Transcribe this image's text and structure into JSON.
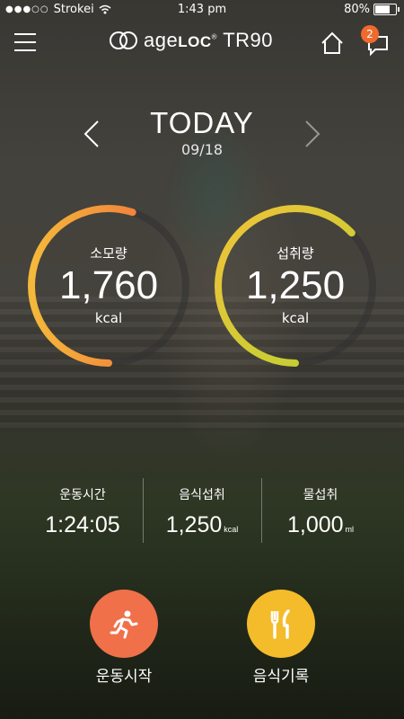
{
  "status_bar": {
    "carrier": "Strokei",
    "time": "1:43 pm",
    "battery": "80%",
    "battery_level": 0.8
  },
  "header": {
    "logo_light": "age",
    "logo_bold": "LOC",
    "logo_reg": "®",
    "logo_product": "TR90",
    "notification_count": "2",
    "icons": [
      "menu-icon",
      "home-icon",
      "chat-icon"
    ]
  },
  "date_nav": {
    "title": "TODAY",
    "date": "09/18"
  },
  "rings": {
    "burned": {
      "label": "소모량",
      "value": "1,760",
      "unit": "kcal",
      "progress": 0.55,
      "colors": [
        "#f16a3c",
        "#f4b93a"
      ]
    },
    "intake": {
      "label": "섭취량",
      "value": "1,250",
      "unit": "kcal",
      "progress": 0.63,
      "colors": [
        "#b9d330",
        "#f0c23a"
      ]
    }
  },
  "stats": [
    {
      "label": "운동시간",
      "value": "1:24:05",
      "unit": ""
    },
    {
      "label": "음식섭취",
      "value": "1,250",
      "unit": "kcal"
    },
    {
      "label": "물섭취",
      "value": "1,000",
      "unit": "ml"
    }
  ],
  "actions": {
    "exercise": {
      "label": "운동시작",
      "color": "#f0704a",
      "icon": "running-icon"
    },
    "meal": {
      "label": "음식기록",
      "color": "#f4bb2a",
      "icon": "fork-knife-icon"
    }
  }
}
